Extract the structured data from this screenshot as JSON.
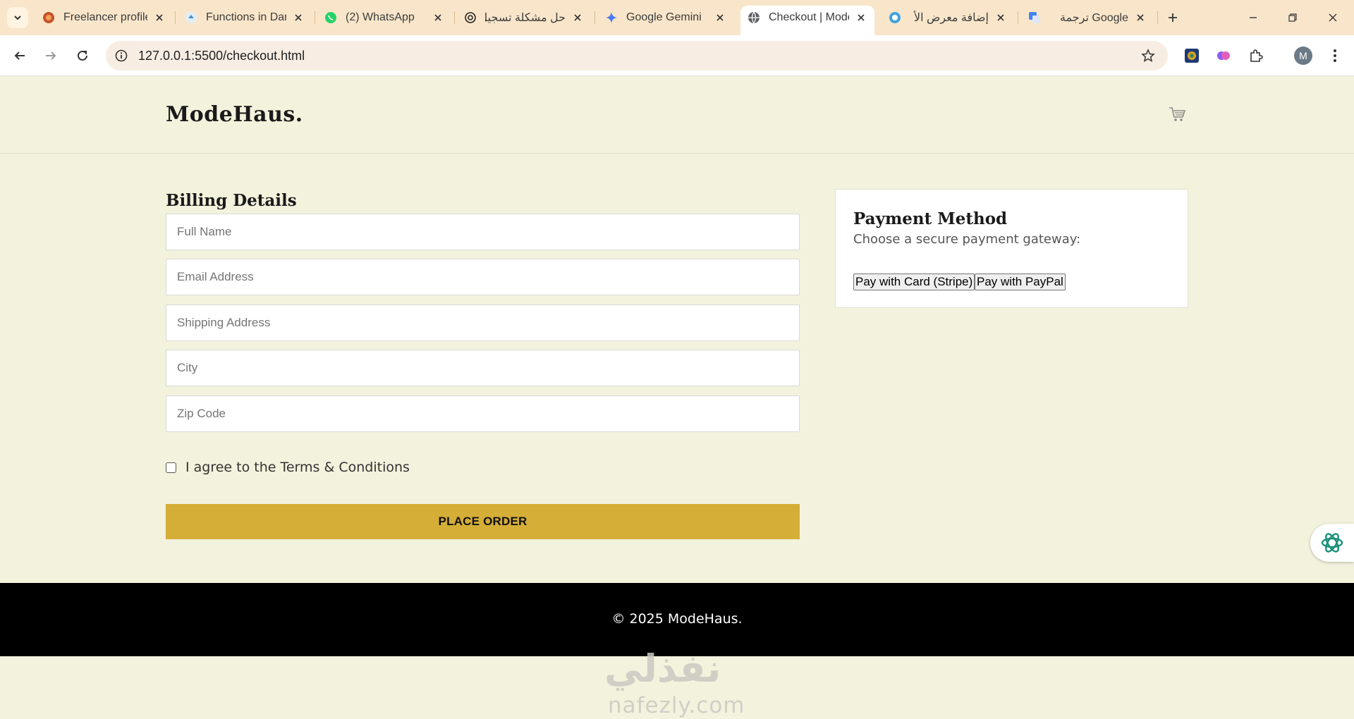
{
  "browser": {
    "tabs": [
      {
        "label": "Freelancer profile",
        "icon": "freelancer-icon"
      },
      {
        "label": "Functions in Dart",
        "icon": "dart-icon"
      },
      {
        "label": "(2) WhatsApp",
        "icon": "whatsapp-icon"
      },
      {
        "label": "حل مشكلة تسجيل",
        "icon": "chatgpt-icon"
      },
      {
        "label": "Google Gemini",
        "icon": "gemini-icon"
      },
      {
        "label": "Checkout | Mode",
        "icon": "globe-icon",
        "active": true
      },
      {
        "label": "إضافة معرض الأ",
        "icon": "chrome-web-icon"
      },
      {
        "label": "Google ترجمة",
        "icon": "translate-icon"
      }
    ],
    "url": "127.0.0.1:5500/checkout.html",
    "profile_initial": "M"
  },
  "header": {
    "brand": "ModeHaus.",
    "cart_icon": "cart-icon"
  },
  "billing": {
    "title": "Billing Details",
    "fields": {
      "full_name": "Full Name",
      "email": "Email Address",
      "shipping": "Shipping Address",
      "city": "City",
      "zip": "Zip Code"
    },
    "agree_label": "I agree to the Terms & Conditions",
    "place_order": "PLACE ORDER"
  },
  "payment": {
    "title": "Payment Method",
    "subtitle": "Choose a secure payment gateway:",
    "stripe_label": "Pay with Card (Stripe)",
    "paypal_label": "Pay with PayPal"
  },
  "footer": {
    "copyright": "© 2025 ModeHaus."
  },
  "watermark": {
    "mark": "نفذلي",
    "domain": "nafezly.com"
  },
  "colors": {
    "page_bg": "#f3f2dd",
    "accent": "#d4ae37",
    "footer_bg": "#000000",
    "tabbar_bg": "#f9e6ca"
  }
}
